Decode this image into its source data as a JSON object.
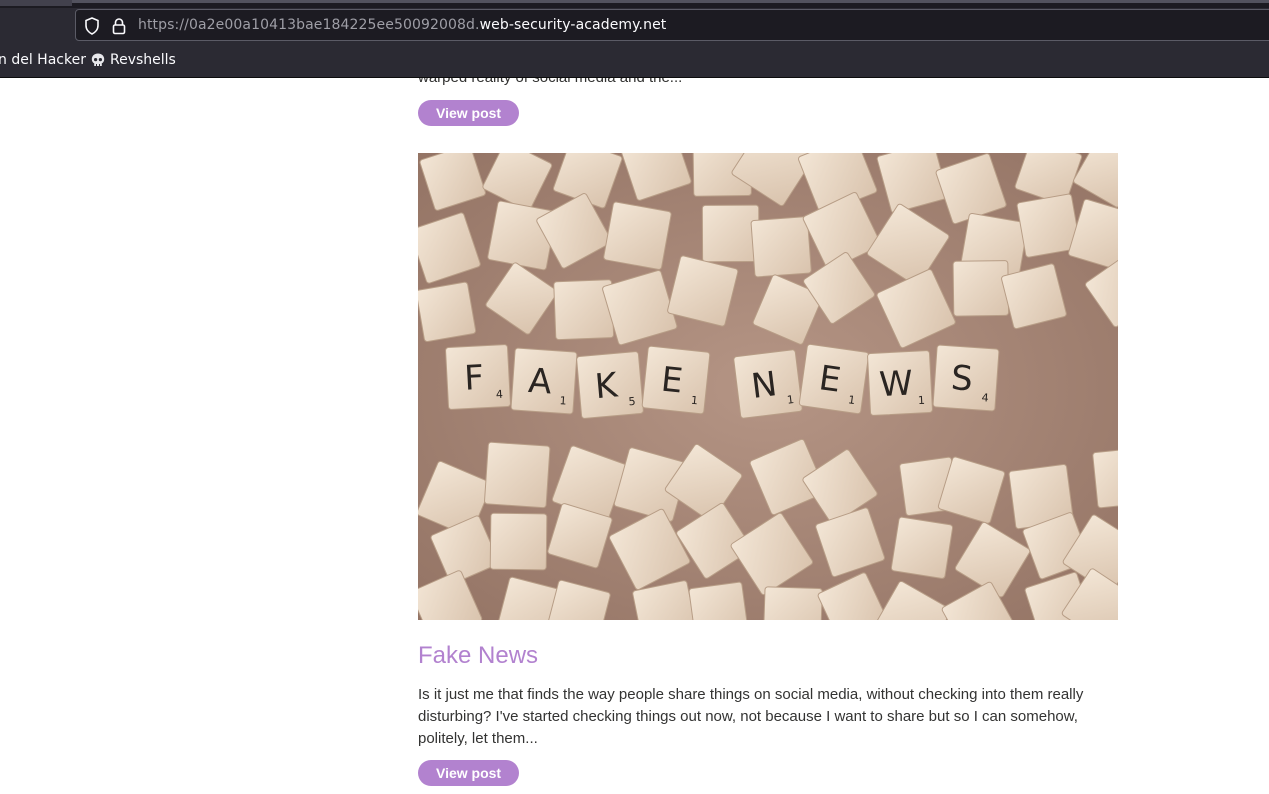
{
  "browser": {
    "url_prefix": "https://0a2e00a10413bae184225ee50092008d.",
    "url_domain": "web-security-academy.net",
    "bookmarks": [
      {
        "label": "n del Hacker"
      },
      {
        "label": "Revshells",
        "icon": "skull-icon"
      }
    ]
  },
  "blog": {
    "previous_snippet": "warped reality of social media and the...",
    "previous_button": "View post",
    "post": {
      "image": "fake-news-scrabble-tiles",
      "image_letters": "FAKE NEWS",
      "title": "Fake News",
      "summary": "Is it just me that finds the way people share things on social media, without checking into them really disturbing? I've started checking things out now, not because I want to share but so I can somehow, politely, let them...",
      "button": "View post"
    }
  },
  "colors": {
    "accent": "#b282cf",
    "text": "#333332",
    "chrome_bg": "#2b2a33",
    "urlbar_bg": "#1c1b22",
    "tile_bg": "#a98a7a"
  }
}
